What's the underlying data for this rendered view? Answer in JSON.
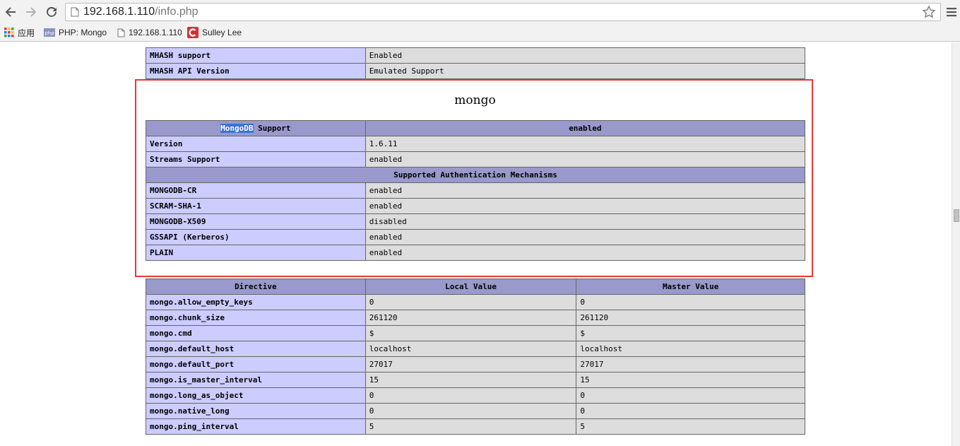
{
  "browser": {
    "url_host": "192.168.1.110",
    "url_path": "/info.php",
    "bookmarks": [
      {
        "label": "应用",
        "icon": "apps-grid-icon"
      },
      {
        "label": "PHP: Mongo",
        "icon": "php-icon"
      },
      {
        "label": "192.168.1.110",
        "icon": "page-icon"
      },
      {
        "label": "Sulley Lee",
        "icon": "c-logo-icon"
      }
    ],
    "colors": {
      "red_highlight": "#e53935",
      "header_blue": "#9999cc",
      "label_blue": "#ccccff",
      "value_gray": "#dddddd"
    }
  },
  "mhash": {
    "rows": [
      {
        "name": "MHASH support",
        "value": "Enabled"
      },
      {
        "name": "MHASH API Version",
        "value": "Emulated Support"
      }
    ]
  },
  "mongo": {
    "title": "mongo",
    "support_header": {
      "name_highlight": "MongoDB",
      "name_rest": " Support",
      "value": "enabled"
    },
    "rows": [
      {
        "name": "Version",
        "value": "1.6.11"
      },
      {
        "name": "Streams Support",
        "value": "enabled"
      }
    ],
    "auth_header": "Supported Authentication Mechanisms",
    "auth_rows": [
      {
        "name": "MONGODB-CR",
        "value": "enabled"
      },
      {
        "name": "SCRAM-SHA-1",
        "value": "enabled"
      },
      {
        "name": "MONGODB-X509",
        "value": "disabled"
      },
      {
        "name": "GSSAPI (Kerberos)",
        "value": "enabled"
      },
      {
        "name": "PLAIN",
        "value": "enabled"
      }
    ]
  },
  "directives": {
    "headers": [
      "Directive",
      "Local Value",
      "Master Value"
    ],
    "rows": [
      [
        "mongo.allow_empty_keys",
        "0",
        "0"
      ],
      [
        "mongo.chunk_size",
        "261120",
        "261120"
      ],
      [
        "mongo.cmd",
        "$",
        "$"
      ],
      [
        "mongo.default_host",
        "localhost",
        "localhost"
      ],
      [
        "mongo.default_port",
        "27017",
        "27017"
      ],
      [
        "mongo.is_master_interval",
        "15",
        "15"
      ],
      [
        "mongo.long_as_object",
        "0",
        "0"
      ],
      [
        "mongo.native_long",
        "0",
        "0"
      ],
      [
        "mongo.ping_interval",
        "5",
        "5"
      ]
    ]
  }
}
